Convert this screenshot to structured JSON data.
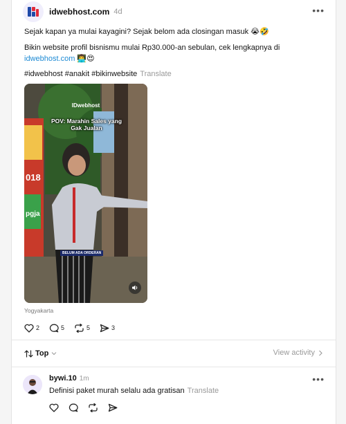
{
  "post": {
    "author": "idwebhost.com",
    "time": "4d",
    "more": "•••",
    "line1": "Sejak kapan ya mulai kayagini? Sejak belom ada closingan masuk 😭🤣",
    "line2_text": "Bikin website profil bisnismu mulai Rp30.000-an sebulan, cek lengkapnya di",
    "line2_link": "idwebhost.com",
    "line2_emoji": " 👨‍💻😍",
    "hashtags": "#idwebhost #anakit #bikinwebsite",
    "translate": "Translate"
  },
  "video": {
    "brand": "IDwebhost",
    "caption": "POV: Marahin Sales yang Gak Jualan",
    "subtitle": "BELUM ADA ORDERAN",
    "sign_text_1": "018",
    "sign_text_2": "pgja",
    "sound_icon": "speaker-icon"
  },
  "location": "Yogyakarta",
  "actions": {
    "likes": "2",
    "comments": "5",
    "reposts": "5",
    "shares": "3"
  },
  "sort": {
    "label": "Top",
    "view_activity": "View activity"
  },
  "reply": {
    "author": "bywi.10",
    "time": "1m",
    "more": "•••",
    "text": "Definisi paket murah selalu ada gratisan",
    "translate": "Translate"
  },
  "colors": {
    "link": "#1d8ad4",
    "muted": "#999999",
    "brand_blue": "#1f4aa8",
    "brand_red": "#e02a3b"
  }
}
